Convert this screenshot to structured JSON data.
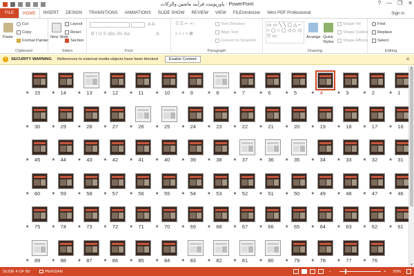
{
  "window": {
    "title": "پاورپوینت فرآیند ماشین والرکات - PowerPoint",
    "help": "?",
    "minimize": "—",
    "restore": "❐",
    "close": "✕"
  },
  "tabs": [
    "FILE",
    "HOME",
    "INSERT",
    "DESIGN",
    "TRANSITIONS",
    "ANIMATIONS",
    "SLIDE SHOW",
    "REVIEW",
    "VIEW",
    "FILEminimizer",
    "Nitro PDF Professional"
  ],
  "active_tab": "HOME",
  "sign_in": "Sign in",
  "ribbon": {
    "clipboard": {
      "paste": "Paste",
      "cut": "Cut",
      "copy": "Copy",
      "format_painter": "Format Painter",
      "label": "Clipboard"
    },
    "slides": {
      "new_slide": "New Slide",
      "layout": "Layout",
      "reset": "Reset",
      "section": "Section",
      "label": "Slides"
    },
    "font": {
      "label": "Font"
    },
    "paragraph": {
      "text_direction": "Text Direction",
      "align_text": "Align Text",
      "convert_smartart": "Convert to SmartArt",
      "label": "Paragraph"
    },
    "drawing": {
      "arrange": "Arrange",
      "quick_styles": "Quick Styles",
      "shape_fill": "Shape Fill",
      "shape_outline": "Shape Outline",
      "shape_effects": "Shape Effects",
      "label": "Drawing"
    },
    "editing": {
      "find": "Find",
      "replace": "Replace",
      "select": "Select",
      "label": "Editing"
    }
  },
  "security_bar": {
    "title": "SECURITY WARNING",
    "message": "References to external media objects have been blocked",
    "button": "Enable Content",
    "close": "✕"
  },
  "slides": {
    "selected": 4,
    "light_thumbs": [
      13,
      8,
      26,
      25,
      36,
      35,
      37,
      89,
      83,
      82,
      81,
      80
    ],
    "rows": [
      [
        15,
        14,
        13,
        12,
        11,
        10,
        9,
        8,
        7,
        6,
        5,
        4,
        3,
        2,
        1
      ],
      [
        30,
        29,
        28,
        27,
        26,
        25,
        24,
        23,
        22,
        21,
        20,
        19,
        18,
        17,
        16
      ],
      [
        45,
        44,
        43,
        42,
        41,
        40,
        39,
        38,
        37,
        36,
        35,
        34,
        33,
        32,
        31
      ],
      [
        60,
        59,
        58,
        57,
        56,
        55,
        54,
        53,
        52,
        51,
        50,
        49,
        48,
        47,
        46
      ],
      [
        75,
        74,
        73,
        72,
        71,
        70,
        69,
        68,
        67,
        66,
        65,
        64,
        63,
        62,
        61
      ],
      [
        89,
        88,
        87,
        86,
        85,
        84,
        83,
        82,
        81,
        80,
        79,
        78,
        77,
        76
      ]
    ]
  },
  "status": {
    "slide_of": "SLIDE 4 OF 89",
    "language": "PERSIAN",
    "zoom": "20%",
    "zoom_minus": "−",
    "zoom_plus": "+"
  },
  "colors": {
    "accent": "#d24726",
    "warning": "#fff4c5"
  }
}
